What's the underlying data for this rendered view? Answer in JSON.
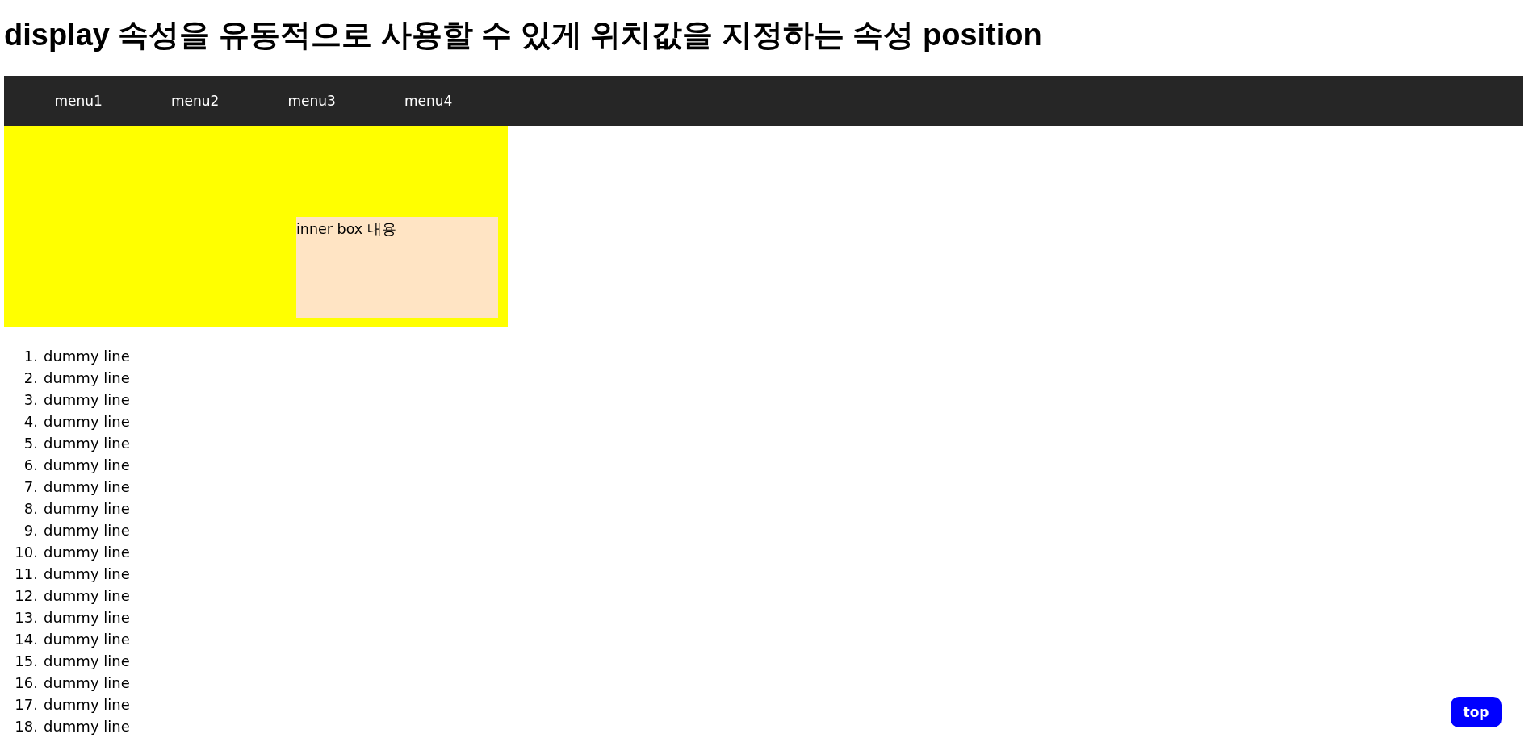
{
  "title": "display 속성을 유동적으로 사용할 수 있게 위치값을 지정하는 속성 position",
  "menu": [
    "menu1",
    "menu2",
    "menu3",
    "menu4"
  ],
  "outer_box": {
    "inner_box": {
      "text": "inner box 내용"
    }
  },
  "list": [
    {
      "number": "1.",
      "text": "dummy line"
    },
    {
      "number": "2.",
      "text": "dummy line"
    },
    {
      "number": "3.",
      "text": "dummy line"
    },
    {
      "number": "4.",
      "text": "dummy line"
    },
    {
      "number": "5.",
      "text": "dummy line"
    },
    {
      "number": "6.",
      "text": "dummy line"
    },
    {
      "number": "7.",
      "text": "dummy line"
    },
    {
      "number": "8.",
      "text": "dummy line"
    },
    {
      "number": "9.",
      "text": "dummy line"
    },
    {
      "number": "10.",
      "text": "dummy line"
    },
    {
      "number": "11.",
      "text": "dummy line"
    },
    {
      "number": "12.",
      "text": "dummy line"
    },
    {
      "number": "13.",
      "text": "dummy line"
    },
    {
      "number": "14.",
      "text": "dummy line"
    },
    {
      "number": "15.",
      "text": "dummy line"
    },
    {
      "number": "16.",
      "text": "dummy line"
    },
    {
      "number": "17.",
      "text": "dummy line"
    },
    {
      "number": "18.",
      "text": "dummy line"
    }
  ],
  "top_button": "top"
}
